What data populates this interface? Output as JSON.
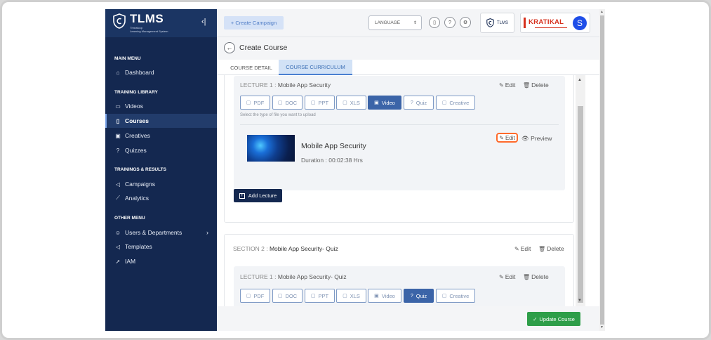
{
  "brand": {
    "name": "TLMS",
    "subtitle_line1": "Threatcop",
    "subtitle_line2": "Learning Management System"
  },
  "sidebar": {
    "sections": [
      {
        "heading": "MAIN MENU",
        "items": [
          {
            "label": "Dashboard",
            "icon": "home-icon"
          }
        ]
      },
      {
        "heading": "TRAINING LIBRARY",
        "items": [
          {
            "label": "Videos",
            "icon": "video-icon"
          },
          {
            "label": "Courses",
            "icon": "book-icon"
          },
          {
            "label": "Creatives",
            "icon": "image-icon"
          },
          {
            "label": "Quizzes",
            "icon": "question-icon"
          }
        ]
      },
      {
        "heading": "TRAININGS & RESULTS",
        "items": [
          {
            "label": "Campaigns",
            "icon": "megaphone-icon"
          },
          {
            "label": "Analytics",
            "icon": "chart-line-icon"
          }
        ]
      },
      {
        "heading": "OTHER MENU",
        "items": [
          {
            "label": "Users & Departments",
            "icon": "user-icon"
          },
          {
            "label": "Templates",
            "icon": "megaphone-icon"
          },
          {
            "label": "IAM",
            "icon": "pointer-icon"
          }
        ]
      }
    ],
    "active_item": "Courses"
  },
  "topbar": {
    "create_campaign": "+ Create Campaign",
    "language": "LANGUAGE",
    "tlms_badge": "TLMS",
    "company": "KRATIKAL",
    "avatar_letter": "S"
  },
  "page": {
    "title": "Create Course",
    "tabs": [
      {
        "label": "COURSE DETAIL",
        "active": false
      },
      {
        "label": "COURSE CURRICULUM",
        "active": true
      }
    ]
  },
  "sections": [
    {
      "lectures": [
        {
          "prefix": "LECTURE 1 :",
          "title": "Mobile App Security",
          "edit": "Edit",
          "delete": "Delete",
          "types": [
            "PDF",
            "DOC",
            "PPT",
            "XLS",
            "Video",
            "Quiz",
            "Creative"
          ],
          "selected_type": "Video",
          "hint": "Select the type of file you want to upload",
          "item": {
            "title": "Mobile App Security",
            "duration": "Duration : 00:02:38  Hrs",
            "edit": "Edit",
            "preview": "Preview"
          }
        }
      ],
      "add_lecture": "Add Lecture"
    },
    {
      "prefix": "SECTION 2 :",
      "title": "Mobile App Security- Quiz",
      "edit": "Edit",
      "delete": "Delete",
      "lectures": [
        {
          "prefix": "LECTURE 1 :",
          "title": "Mobile App Security- Quiz",
          "edit": "Edit",
          "delete": "Delete",
          "types": [
            "PDF",
            "DOC",
            "PPT",
            "XLS",
            "Video",
            "Quiz",
            "Creative"
          ],
          "selected_type": "Quiz"
        }
      ]
    }
  ],
  "footer": {
    "update_button": "Update Course"
  },
  "colors": {
    "sidebar": "#142850",
    "accent": "#3b64a8",
    "success": "#2e9e49",
    "highlight": "#ff6a2b",
    "brand_red": "#d6301d"
  }
}
